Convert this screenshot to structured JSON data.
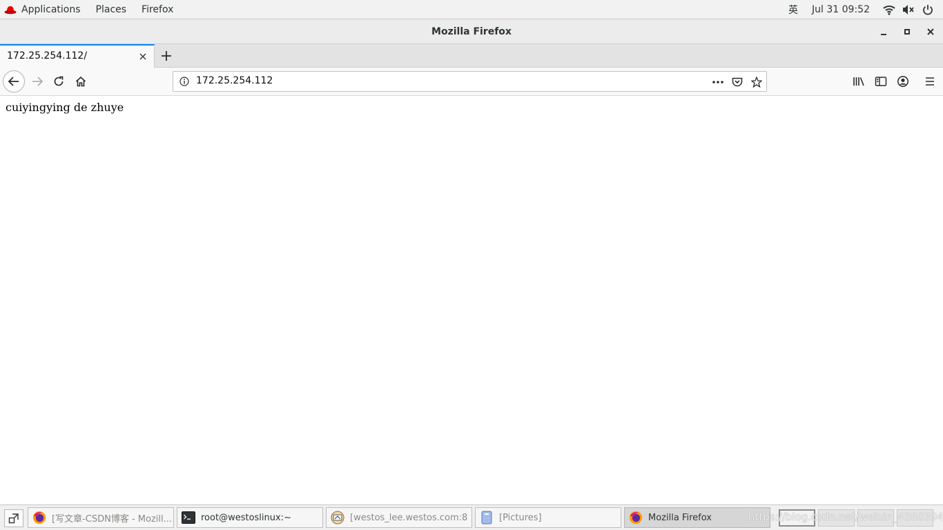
{
  "topbar": {
    "applications_label": "Applications",
    "places_label": "Places",
    "app_menu_label": "Firefox",
    "input_method": "英",
    "clock": "Jul 31  09:52"
  },
  "window": {
    "title": "Mozilla Firefox"
  },
  "tabs": [
    {
      "label": "172.25.254.112/"
    }
  ],
  "navbar": {
    "url": "172.25.254.112"
  },
  "page": {
    "body_text": "cuiyingying de zhuye"
  },
  "taskbar": {
    "tasks": [
      {
        "label": "[写文章-CSDN博客 - Mozill...",
        "icon": "firefox-icon"
      },
      {
        "label": "root@westoslinux:~",
        "icon": "terminal-icon"
      },
      {
        "label": "[westos_lee.westos.com:8 ...",
        "icon": "remote-viewer-icon"
      },
      {
        "label": "[Pictures]",
        "icon": "file-manager-icon"
      },
      {
        "label": "Mozilla Firefox",
        "icon": "firefox-icon"
      }
    ],
    "watermark": "https://blog.csdn.net/weixin_43803940"
  },
  "colors": {
    "tab_accent": "#0a84ff",
    "redhat_red": "#ee0000"
  }
}
